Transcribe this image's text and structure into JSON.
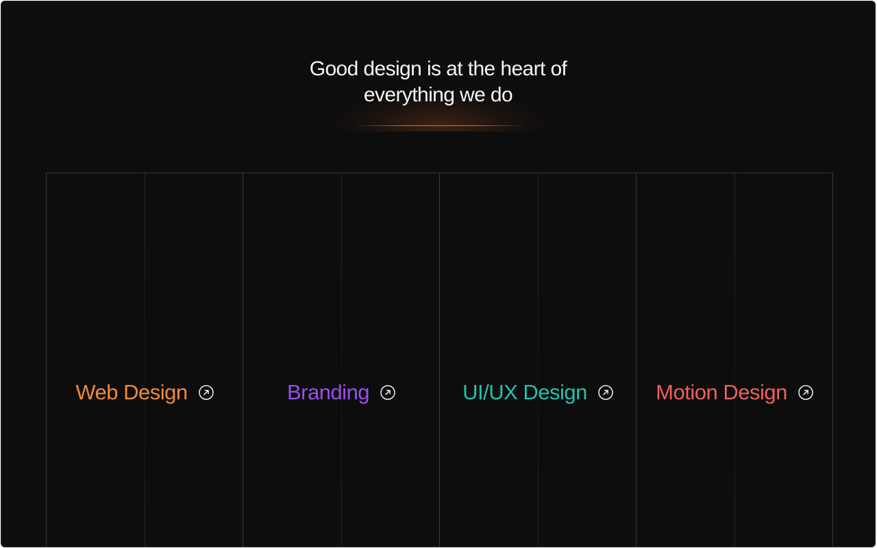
{
  "headline": {
    "line1": "Good design is at the heart of",
    "line2": "everything we do"
  },
  "services": [
    {
      "label": "Web Design",
      "color": "#f08a3c",
      "icon": "arrow-up-right-circle-icon"
    },
    {
      "label": "Branding",
      "color": "#9b4ef0",
      "icon": "arrow-up-right-circle-icon"
    },
    {
      "label": "UI/UX Design",
      "color": "#22c3b0",
      "icon": "arrow-up-right-circle-icon"
    },
    {
      "label": "Motion Design",
      "color": "#f0605e",
      "icon": "arrow-up-right-circle-icon"
    }
  ],
  "colors": {
    "background": "#0d0d0d",
    "text": "#f5f5f5",
    "accent_glow": "#f07832",
    "grid_line": "#3a3a3a"
  }
}
